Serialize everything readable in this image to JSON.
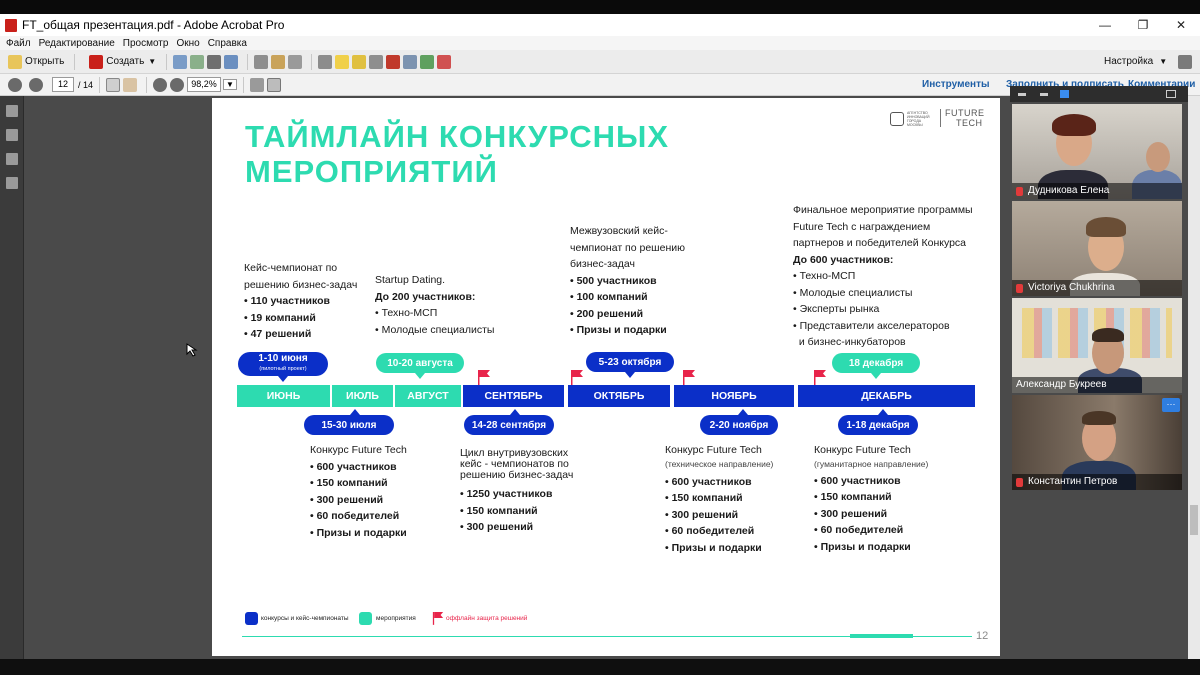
{
  "window": {
    "title": "FT_общая презентация.pdf - Adobe Acrobat Pro",
    "minimize": "—",
    "maximize": "❐",
    "close": "✕"
  },
  "menu": [
    "Файл",
    "Редактирование",
    "Просмотр",
    "Окно",
    "Справка"
  ],
  "toolbar": {
    "open_label": "Открыть",
    "create_label": "Создать",
    "settings_label": "Настройка"
  },
  "nav": {
    "page_current": "12",
    "page_total": "/ 14",
    "zoom": "98,2%",
    "tab_tools": "Инструменты",
    "tab_sign": "Заполнить и подписать",
    "tab_comments": "Комментарии"
  },
  "slide": {
    "title_line1": "ТАЙМЛАЙН КОНКУРСНЫХ",
    "title_line2": "МЕРОПРИЯТИЙ",
    "logo_text1": "FUTURE",
    "logo_text2": "TECH",
    "logo_small": "АГЕНТСТВО ИННОВАЦИЙ ГОРОДА МОСКВЫ",
    "page_number": "12",
    "months": {
      "june": "ИЮНЬ",
      "july": "ИЮЛЬ",
      "august": "АВГУСТ",
      "september": "СЕНТЯБРЬ",
      "october": "ОКТЯБРЬ",
      "november": "НОЯБРЬ",
      "december": "ДЕКАБРЬ"
    },
    "pills": {
      "june_dates": "1-10 июня",
      "june_note": "(пилотный проект)",
      "august_dates": "10-20 августа",
      "october_dates": "5-23 октября",
      "december_top": "18 декабря",
      "july_dates": "15-30 июля",
      "september_dates": "14-28 сентября",
      "november_dates": "2-20 ноября",
      "december_bottom": "1-18 декабря"
    },
    "top_blocks": {
      "case": {
        "title1": "Кейс-чемпионат по",
        "title2": "решению бизнес-задач",
        "items": [
          "110 участников",
          "19 компаний",
          "47 решений"
        ]
      },
      "dating": {
        "title": "Startup Dating.",
        "subtitle": "До 200 участников:",
        "items": [
          "Техно-МСП",
          "Молодые специалисты"
        ]
      },
      "interuni": {
        "title1": "Межвузовский кейс-",
        "title2": "чемпионат по решению",
        "title3": "бизнес-задач",
        "items": [
          "500 участников",
          "100 компаний",
          "200 решений",
          "Призы и подарки"
        ]
      },
      "final": {
        "title1": "Финальное мероприятие программы",
        "title2": "Future Tech с награждением",
        "title3": "партнеров и победителей Конкурса",
        "subtitle": "До 600 участников:",
        "items": [
          "Техно-МСП",
          "Молодые специалисты",
          "Эксперты рынка",
          "Представители акселераторов",
          "и бизнес-инкубаторов"
        ]
      }
    },
    "bottom_blocks": {
      "july": {
        "title": "Конкурс Future Tech",
        "items": [
          "600 участников",
          "150 компаний",
          "300 решений",
          "60 победителей",
          "Призы и подарки"
        ]
      },
      "september": {
        "title1": "Цикл внутривузовских",
        "title2": "кейс - чемпионатов по",
        "title3": "решению бизнес-задач",
        "items": [
          "1250 участников",
          "150 компаний",
          "300 решений"
        ]
      },
      "november": {
        "title": "Конкурс Future Tech",
        "note": "(техническое направление)",
        "items": [
          "600 участников",
          "150 компаний",
          "300 решений",
          "60 победителей",
          "Призы и подарки"
        ]
      },
      "december": {
        "title": "Конкурс Future Tech",
        "note": "(гуманитарное направление)",
        "items": [
          "600 участников",
          "150 компаний",
          "300 решений",
          "60 победителей",
          "Призы и подарки"
        ]
      }
    },
    "legend": {
      "contests": "конкурсы и кейс-чемпионаты",
      "events": "мероприятия",
      "offline": "оффлайн защита решений"
    },
    "colors": {
      "blue": "#0b2fc8",
      "teal": "#2ddbb0",
      "red": "#e8244a"
    }
  },
  "participants": [
    {
      "name": "Дудникова Елена"
    },
    {
      "name": "Victoriya Chukhrina"
    },
    {
      "name": "Александр Букреев"
    },
    {
      "name": "Константин Петров"
    }
  ],
  "participants_more": "···"
}
